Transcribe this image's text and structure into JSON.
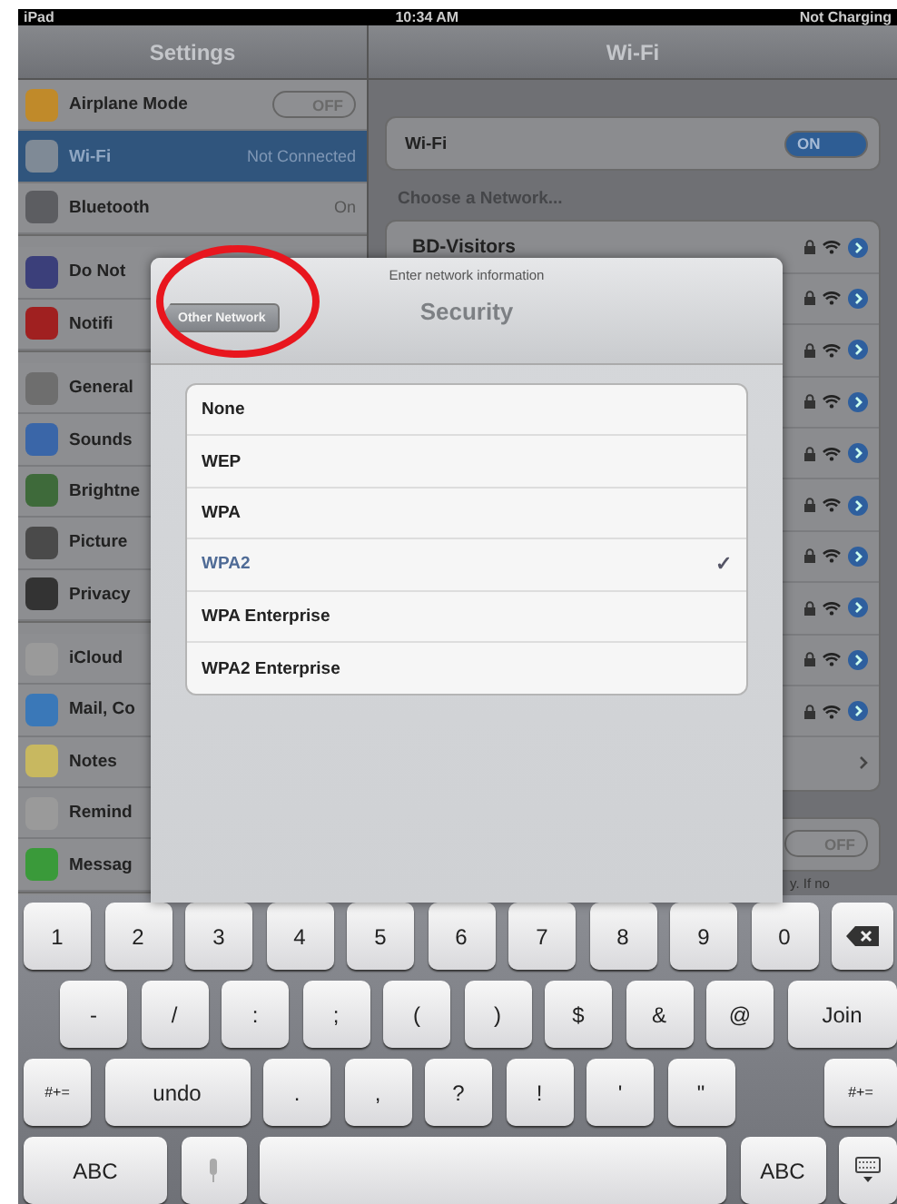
{
  "status_bar": {
    "carrier": "iPad",
    "time": "10:34 AM",
    "battery": "Not Charging"
  },
  "sidebar": {
    "title": "Settings",
    "groups": [
      {
        "items": [
          {
            "label": "Airplane Mode",
            "kind": "switch",
            "on": false,
            "switch_text": "OFF",
            "selected": false,
            "color": "#c08a2a"
          },
          {
            "label": "Wi-Fi",
            "kind": "link",
            "value": "Not Connected",
            "selected": true,
            "color": "#7f8a96"
          },
          {
            "label": "Bluetooth",
            "kind": "link",
            "value": "On",
            "selected": false,
            "color": "#5c5d61"
          }
        ]
      },
      {
        "items": [
          {
            "label": "Do Not",
            "kind": "link",
            "selected": false,
            "color": "#3b3f7a"
          },
          {
            "label": "Notifi",
            "kind": "link",
            "selected": false,
            "color": "#a02020"
          }
        ]
      },
      {
        "items": [
          {
            "label": "General",
            "kind": "link",
            "selected": false,
            "color": "#6e6e6e"
          },
          {
            "label": "Sounds",
            "kind": "link",
            "selected": false,
            "color": "#3a66a8"
          },
          {
            "label": "Brightne",
            "kind": "link",
            "selected": false,
            "color": "#3e6a3a"
          },
          {
            "label": "Picture",
            "kind": "link",
            "selected": false,
            "color": "#4a4a4a"
          },
          {
            "label": "Privacy",
            "kind": "link",
            "selected": false,
            "color": "#333333"
          }
        ]
      },
      {
        "items": [
          {
            "label": "iCloud",
            "kind": "link",
            "selected": false,
            "color": "#9a9a9a"
          },
          {
            "label": "Mail, Co",
            "kind": "link",
            "selected": false,
            "color": "#3a78b8"
          },
          {
            "label": "Notes",
            "kind": "link",
            "selected": false,
            "color": "#c8b860"
          },
          {
            "label": "Remind",
            "kind": "link",
            "selected": false,
            "color": "#9a9a9a"
          },
          {
            "label": "Messag",
            "kind": "link",
            "selected": false,
            "color": "#3a9a3a"
          }
        ]
      }
    ]
  },
  "detail": {
    "title": "Wi-Fi",
    "wifi": {
      "label": "Wi-Fi",
      "on": true,
      "switch_text": "ON"
    },
    "section_label": "Choose a Network...",
    "networks": [
      {
        "name": "BD-Visitors",
        "locked": true
      },
      {
        "locked": true
      },
      {
        "locked": true
      },
      {
        "locked": true
      },
      {
        "locked": true
      },
      {
        "locked": true
      },
      {
        "locked": true
      },
      {
        "locked": true
      },
      {
        "locked": true
      },
      {
        "locked": true
      }
    ],
    "ask_to_join": {
      "on": false,
      "switch_text": "OFF",
      "note": "y. If no"
    }
  },
  "popover": {
    "header": "Enter network information",
    "back_button": "Other Network",
    "title": "Security",
    "check_symbol": "✓",
    "options": [
      {
        "label": "None",
        "selected": false
      },
      {
        "label": "WEP",
        "selected": false
      },
      {
        "label": "WPA",
        "selected": false
      },
      {
        "label": "WPA2",
        "selected": true
      },
      {
        "label": "WPA Enterprise",
        "selected": false
      },
      {
        "label": "WPA2 Enterprise",
        "selected": false
      }
    ]
  },
  "keyboard": {
    "rows": [
      [
        {
          "kind": "char",
          "label": "1"
        },
        {
          "kind": "char",
          "label": "2"
        },
        {
          "kind": "char",
          "label": "3"
        },
        {
          "kind": "char",
          "label": "4"
        },
        {
          "kind": "char",
          "label": "5"
        },
        {
          "kind": "char",
          "label": "6"
        },
        {
          "kind": "char",
          "label": "7"
        },
        {
          "kind": "char",
          "label": "8"
        },
        {
          "kind": "char",
          "label": "9"
        },
        {
          "kind": "char",
          "label": "0"
        },
        {
          "kind": "delete"
        }
      ],
      [
        {
          "kind": "char",
          "label": "-"
        },
        {
          "kind": "char",
          "label": "/"
        },
        {
          "kind": "char",
          "label": ":"
        },
        {
          "kind": "char",
          "label": ";"
        },
        {
          "kind": "char",
          "label": "("
        },
        {
          "kind": "char",
          "label": ")"
        },
        {
          "kind": "char",
          "label": "$"
        },
        {
          "kind": "char",
          "label": "&"
        },
        {
          "kind": "char",
          "label": "@"
        },
        {
          "kind": "join",
          "label": "Join"
        }
      ],
      [
        {
          "kind": "shift",
          "label": "#+="
        },
        {
          "kind": "undo",
          "label": "undo"
        },
        {
          "kind": "char",
          "label": "."
        },
        {
          "kind": "char",
          "label": ","
        },
        {
          "kind": "char",
          "label": "?"
        },
        {
          "kind": "char",
          "label": "!"
        },
        {
          "kind": "char",
          "label": "'"
        },
        {
          "kind": "char",
          "label": "\""
        },
        {
          "kind": "shift_right",
          "label": "#+="
        }
      ],
      [
        {
          "kind": "abc",
          "label": "ABC"
        },
        {
          "kind": "mic"
        },
        {
          "kind": "space"
        },
        {
          "kind": "abc_right",
          "label": "ABC"
        },
        {
          "kind": "hide"
        }
      ]
    ]
  }
}
